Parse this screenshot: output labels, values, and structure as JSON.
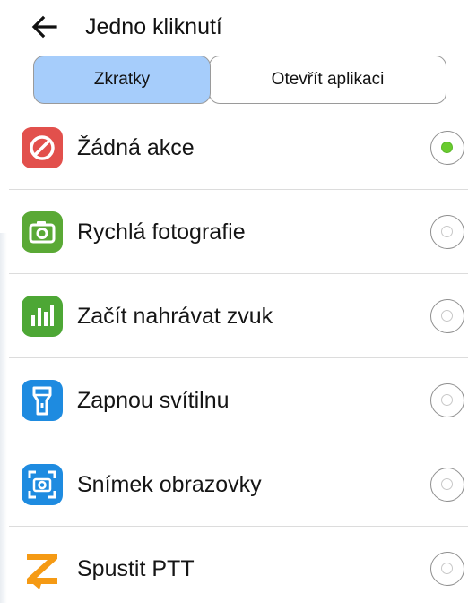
{
  "header": {
    "title": "Jedno kliknutí",
    "back_icon": "arrow-left-icon"
  },
  "tabs": [
    {
      "label": "Zkratky",
      "selected": true
    },
    {
      "label": "Otevřít aplikaci",
      "selected": false
    }
  ],
  "options": [
    {
      "label": "Žádná akce",
      "icon": "no-action-icon",
      "icon_color": "#e2504c",
      "selected": true
    },
    {
      "label": "Rychlá fotografie",
      "icon": "camera-icon",
      "icon_color": "#5aa935",
      "selected": false
    },
    {
      "label": "Začít nahrávat zvuk",
      "icon": "audio-bars-icon",
      "icon_color": "#4da735",
      "selected": false
    },
    {
      "label": "Zapnou svítilnu",
      "icon": "flashlight-icon",
      "icon_color": "#1e8be0",
      "selected": false
    },
    {
      "label": "Snímek obrazovky",
      "icon": "screenshot-icon",
      "icon_color": "#1e8be0",
      "selected": false
    },
    {
      "label": "Spustit PTT",
      "icon": "ptt-z-icon",
      "icon_color": "#f59a14",
      "selected": false
    }
  ],
  "colors": {
    "accent_selected_tab": "#a6cdfb",
    "radio_selected": "#6acb2f"
  }
}
